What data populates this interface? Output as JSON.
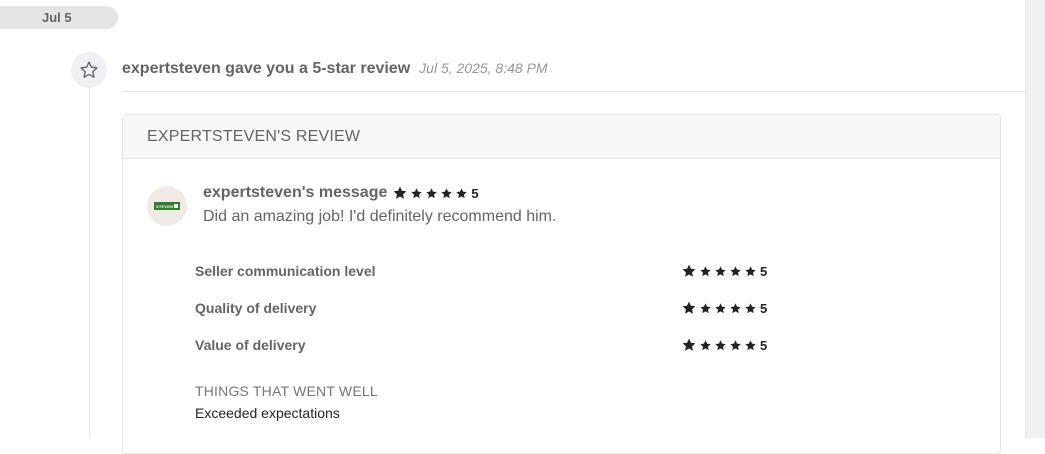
{
  "timeline": {
    "date_label": "Jul 5"
  },
  "event": {
    "icon": "star-outline-icon",
    "title": "expertsteven gave you a 5-star review",
    "timestamp": "Jul 5, 2025, 8:48 PM"
  },
  "review_card": {
    "header": "EXPERTSTEVEN'S REVIEW",
    "avatar_logo_text": "STEVEN",
    "message_author": "expertsteven's message",
    "overall_rating": "5",
    "overall_stars": 5,
    "message_text": "Did an amazing job! I'd definitely recommend him.",
    "criteria": [
      {
        "label": "Seller communication level",
        "stars": 5,
        "rating": "5"
      },
      {
        "label": "Quality of delivery",
        "stars": 5,
        "rating": "5"
      },
      {
        "label": "Value of delivery",
        "stars": 5,
        "rating": "5"
      }
    ],
    "went_well_heading": "THINGS THAT WENT WELL",
    "went_well_items": [
      "Exceeded expectations"
    ]
  },
  "colors": {
    "star": "#222325",
    "date_pill": "#e4e5e7",
    "logo_green": "#2e7d32"
  }
}
